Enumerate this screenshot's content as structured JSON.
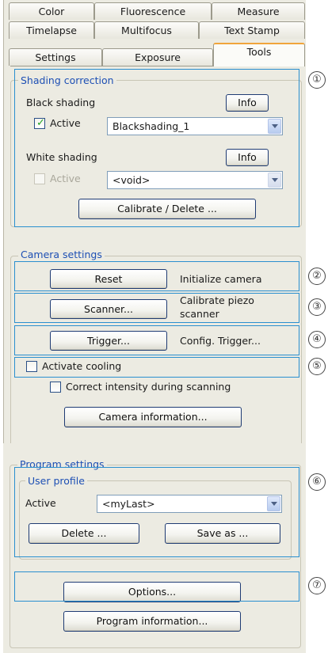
{
  "tabs": {
    "row1": [
      "Color",
      "Fluorescence",
      "Measure"
    ],
    "row2": [
      "Timelapse",
      "Multifocus",
      "Text Stamp"
    ],
    "row3": [
      "Settings",
      "Exposure",
      "Tools"
    ],
    "active": "Tools"
  },
  "shading": {
    "title": "Shading correction",
    "black_label": "Black shading",
    "black_info": "Info",
    "black_active_label": "Active",
    "black_active_checked": true,
    "black_value": "Blackshading_1",
    "white_label": "White shading",
    "white_info": "Info",
    "white_active_label": "Active",
    "white_active_checked": false,
    "white_value": "<void>",
    "calibrate": "Calibrate / Delete ..."
  },
  "camera": {
    "title": "Camera settings",
    "reset": "Reset",
    "reset_desc": "Initialize camera",
    "scanner": "Scanner...",
    "scanner_desc_1": "Calibrate piezo",
    "scanner_desc_2": "scanner",
    "trigger": "Trigger...",
    "trigger_desc": "Config. Trigger...",
    "cooling": "Activate cooling",
    "correct": "Correct intensity during scanning",
    "info": "Camera information..."
  },
  "program": {
    "title": "Program settings",
    "user_profile_title": "User profile",
    "active_label": "Active",
    "active_value": "<myLast>",
    "delete": "Delete ...",
    "save_as": "Save as ...",
    "options": "Options...",
    "info": "Program information..."
  },
  "callouts": [
    "①",
    "②",
    "③",
    "④",
    "⑤",
    "⑥",
    "⑦"
  ]
}
